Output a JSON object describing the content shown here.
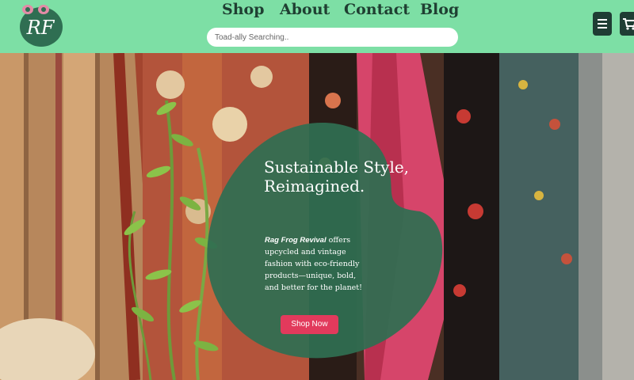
{
  "header": {
    "logo_text": "RF",
    "nav": [
      {
        "label": "Shop"
      },
      {
        "label": "About"
      },
      {
        "label": "Contact"
      },
      {
        "label": "Blog"
      }
    ],
    "search": {
      "placeholder": "Toad-ally Searching.."
    },
    "menu_icon": "hamburger-icon",
    "cart_icon": "cart-icon"
  },
  "hero": {
    "headline": "Sustainable Style, Reimagined.",
    "brand_name": "Rag Frog Revival",
    "description": " offers upcycled and vintage fashion with eco-friendly products—unique, bold, and better for the planet!",
    "cta_label": "Shop Now"
  },
  "colors": {
    "header_bg": "#7ddfa5",
    "nav_text": "#1f3f32",
    "button_dark": "#1f3d34",
    "cta": "#e23a5c",
    "blob": "#2f6e52"
  }
}
